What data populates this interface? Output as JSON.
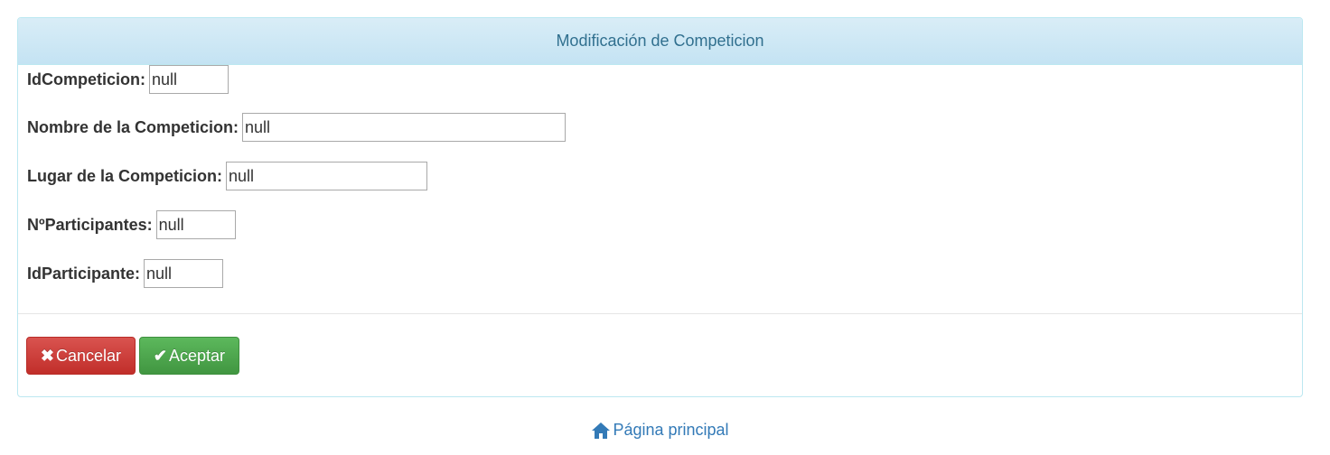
{
  "panel": {
    "title": "Modificación de Competicion"
  },
  "form": {
    "fields": [
      {
        "label": "IdCompeticion:",
        "value": "null"
      },
      {
        "label": "Nombre de la Competicion:",
        "value": "null"
      },
      {
        "label": "Lugar de la Competicion:",
        "value": "null"
      },
      {
        "label": "NºParticipantes:",
        "value": "null"
      },
      {
        "label": "IdParticipante:",
        "value": "null"
      }
    ]
  },
  "buttons": {
    "cancel_icon": "✖",
    "cancel_label": "Cancelar",
    "accept_icon": "✔",
    "accept_label": "Aceptar"
  },
  "footer": {
    "home_label": "Página principal",
    "home_icon": "home-icon"
  },
  "colors": {
    "heading_bg": "#d9edf7",
    "heading_text": "#31708f",
    "danger": "#d9534f",
    "success": "#5cb85c",
    "link": "#337ab7"
  }
}
